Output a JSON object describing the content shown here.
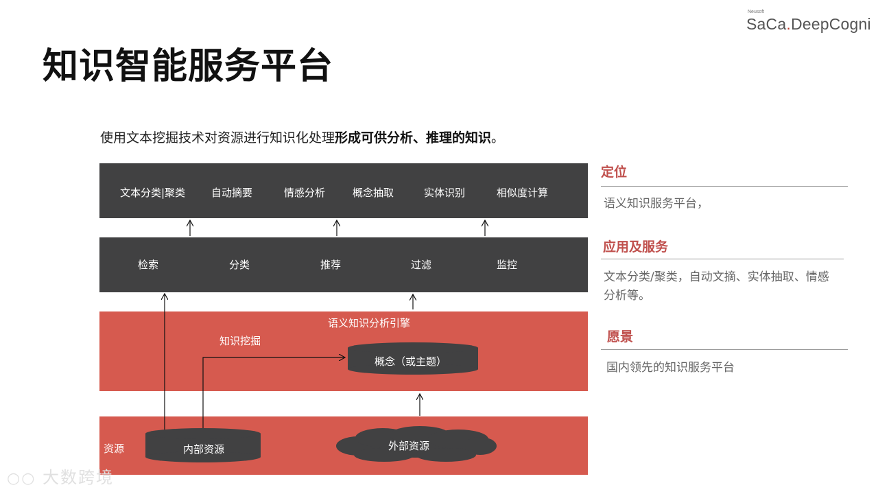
{
  "logo": {
    "small": "Neusoft",
    "brand_left": "SaCa",
    "brand_dot": ".",
    "brand_right": "DeepCogni"
  },
  "title": "知识智能服务平台",
  "intro": {
    "normal": "使用文本挖掘技术对资源进行知识化处理",
    "bold": "形成可供分析、推理的知识",
    "end": "。"
  },
  "diagram": {
    "top_band": [
      "文本分类|聚类",
      "自动摘要",
      "情感分析",
      "概念抽取",
      "实体识别",
      "相似度计算"
    ],
    "middle_band": [
      "检索",
      "分类",
      "推荐",
      "过滤",
      "监控"
    ],
    "engine": {
      "title": "语义知识分析引擎",
      "mining": "知识挖掘",
      "concept": "概念（或主题）"
    },
    "resources": {
      "label": "资源",
      "internal": "内部资源",
      "external": "外部资源"
    }
  },
  "sidebar": {
    "positioning": {
      "heading": "定位",
      "text": "语义知识服务平台，"
    },
    "application": {
      "heading": "应用及服务",
      "text": "文本分类/聚类，自动文摘、实体抽取、情感分析等。"
    },
    "vision": {
      "heading": "愿景",
      "text": "国内领先的知识服务平台"
    }
  },
  "watermark": "大数跨境",
  "colors": {
    "dark_band": "#414142",
    "red_band": "#d65a4f",
    "heading": "#c0504d"
  }
}
